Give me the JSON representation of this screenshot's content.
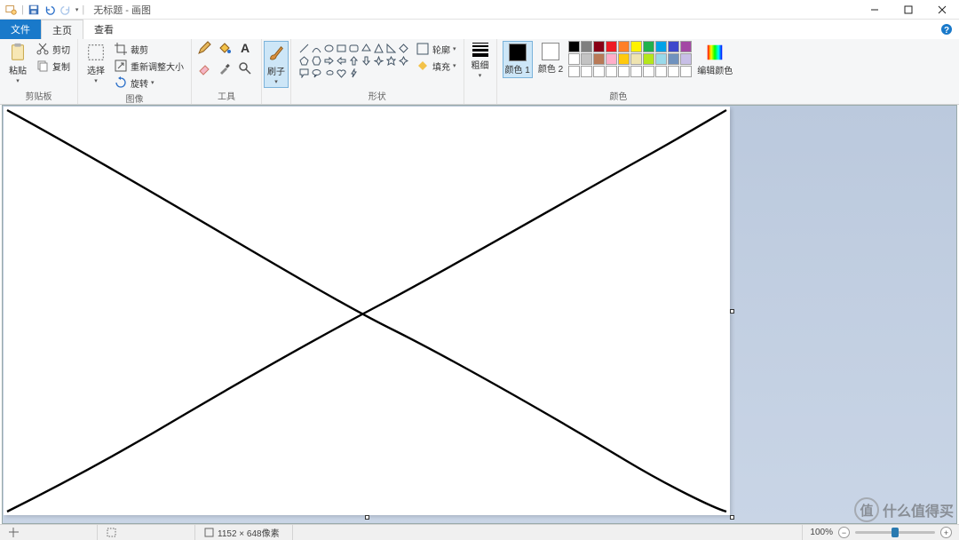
{
  "title": {
    "doc": "无标题",
    "app": "画图"
  },
  "tabs": {
    "file": "文件",
    "home": "主页",
    "view": "查看"
  },
  "clipboard": {
    "paste": "粘贴",
    "cut": "剪切",
    "copy": "复制",
    "label": "剪贴板"
  },
  "image": {
    "select": "选择",
    "crop": "裁剪",
    "resize": "重新调整大小",
    "rotate": "旋转",
    "label": "图像"
  },
  "tools": {
    "label": "工具"
  },
  "brushes": {
    "brush": "刷子"
  },
  "shapes": {
    "outline": "轮廓",
    "fill": "填充",
    "label": "形状"
  },
  "size": {
    "label": "粗细"
  },
  "colors": {
    "color1": "颜色 1",
    "color2": "颜色 2",
    "edit": "编辑颜色",
    "label": "颜色",
    "c1": "#000000",
    "c2": "#ffffff",
    "palette": [
      "#000000",
      "#7f7f7f",
      "#880015",
      "#ed1c24",
      "#ff7f27",
      "#fff200",
      "#22b14c",
      "#00a2e8",
      "#3f48cc",
      "#a349a4",
      "#ffffff",
      "#c3c3c3",
      "#b97a57",
      "#ffaec9",
      "#ffc90e",
      "#efe4b0",
      "#b5e61d",
      "#99d9ea",
      "#7092be",
      "#c8bfe7",
      "#ffffff",
      "#ffffff",
      "#ffffff",
      "#ffffff",
      "#ffffff",
      "#ffffff",
      "#ffffff",
      "#ffffff",
      "#ffffff",
      "#ffffff"
    ]
  },
  "status": {
    "dims": "1152 × 648像素",
    "zoom": "100%"
  },
  "watermark": {
    "badge": "值",
    "text": "什么值得买"
  }
}
